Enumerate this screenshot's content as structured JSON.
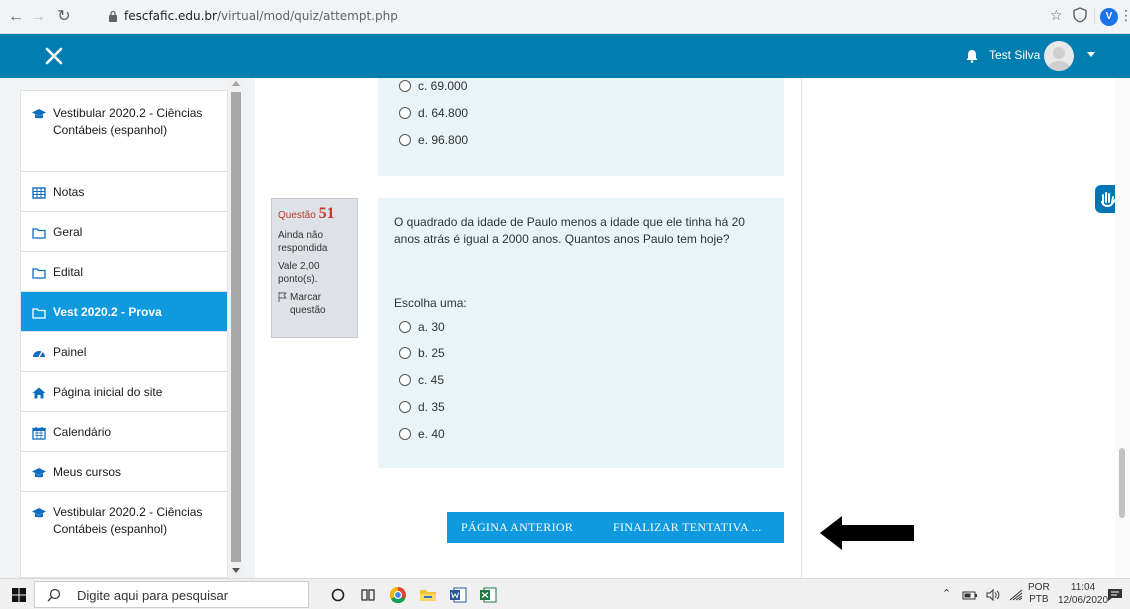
{
  "browser": {
    "url_host": "fescfafic.edu.br",
    "url_path": "/virtual/mod/quiz/attempt.php",
    "profile_letter": "V"
  },
  "navbar": {
    "username": "Test Silva"
  },
  "sidebar": {
    "items": [
      {
        "label": "Vestibular 2020.2 - Ciências Contábeis (espanhol)",
        "icon": "graduation-cap-icon"
      },
      {
        "label": "Notas",
        "icon": "table-icon"
      },
      {
        "label": "Geral",
        "icon": "folder-icon"
      },
      {
        "label": "Edital",
        "icon": "folder-icon"
      },
      {
        "label": "Vest 2020.2 - Prova",
        "icon": "folder-icon",
        "active": true
      },
      {
        "label": "Painel",
        "icon": "dashboard-icon"
      },
      {
        "label": "Página inicial do site",
        "icon": "home-icon"
      },
      {
        "label": "Calendário",
        "icon": "calendar-icon"
      },
      {
        "label": "Meus cursos",
        "icon": "graduation-cap-icon"
      },
      {
        "label": "Vestibular 2020.2 - Ciências Contábeis (espanhol)",
        "icon": "graduation-cap-icon"
      }
    ]
  },
  "prev_question": {
    "options": [
      "c. 69.000",
      "d. 64.800",
      "e. 96.800"
    ]
  },
  "question": {
    "label": "Questão",
    "number": "51",
    "status": "Ainda não respondida",
    "grade": "Vale 2,00 ponto(s).",
    "flag": "Marcar questão",
    "text": "O quadrado da idade de Paulo menos a idade que ele tinha há 20 anos atrás é igual a 2000 anos. Quantos anos Paulo tem hoje?",
    "prompt": "Escolha uma:",
    "options": [
      "a. 30",
      "b. 25",
      "c. 45",
      "d. 35",
      "e. 40"
    ]
  },
  "buttons": {
    "prev_page": "PÁGINA ANTERIOR",
    "finish": "FINALIZAR TENTATIVA ..."
  },
  "taskbar": {
    "search_placeholder": "Digite aqui para pesquisar",
    "lang_top": "POR",
    "lang_bottom": "PTB",
    "time": "11:04",
    "date": "12/06/2020"
  }
}
